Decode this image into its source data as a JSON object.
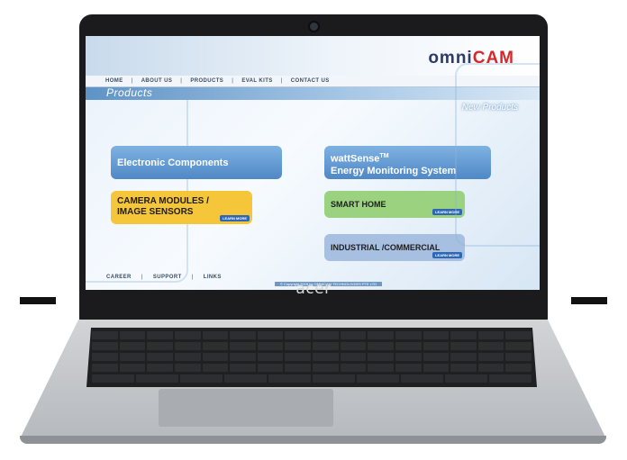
{
  "device": {
    "brand": "acer"
  },
  "site": {
    "logo": {
      "part1": "omni",
      "part2": "CAM",
      "colors": {
        "omni": "#2c3a6d",
        "cam": "#d62828"
      }
    },
    "nav": [
      "HOME",
      "ABOUT US",
      "PRODUCTS",
      "EVAL KITS",
      "CONTACT US"
    ],
    "page_title": "Products",
    "new_products_label": "New Products",
    "cards": {
      "electronic": "Electronic Components",
      "watt_line1": "wattSense",
      "watt_tm": "TM",
      "watt_line2": "Energy Monitoring System",
      "camera_line1": "CAMERA MODULES /",
      "camera_line2": "IMAGE SENSORS",
      "smart_home": "SMART HOME",
      "industrial": "INDUSTRIAL /COMMERCIAL",
      "learn_more": "LEARN MORE"
    },
    "footer_nav": [
      "CAREER",
      "SUPPORT",
      "LINKS"
    ],
    "copyright": "© Copyright 2015 by OMNICAM TECHNOLOGIES PTE LTD"
  }
}
